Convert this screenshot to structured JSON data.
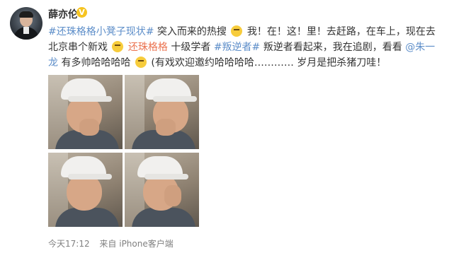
{
  "post": {
    "author": "薛亦伦",
    "content": {
      "tag1": "#还珠格格小凳子现状#",
      "text1": "突入而来的热搜",
      "text2": "我！在！这！里！去赶路，在车上，现在去北京串个新戏",
      "tag2": "还珠格格",
      "text3": "十级学者",
      "tag3": "#叛逆者#",
      "text4": "叛逆者看起来，我在追剧，看看",
      "mention": "@朱一龙",
      "text5": "有多帅哈哈哈哈",
      "text6": "(有戏欢迎邀约哈哈哈哈………… 岁月是把杀猪刀哇！"
    },
    "photos": [
      "photo-1",
      "photo-2",
      "photo-3",
      "photo-4"
    ],
    "time": "今天17:12",
    "source": "来自 iPhone客户端"
  },
  "icons": {
    "verified": "verified-badge-icon",
    "emoji": "emoji-icon"
  },
  "colors": {
    "link_blue": "#5d8ec9",
    "link_orange": "#eb7350",
    "text": "#333333",
    "meta": "#808080"
  }
}
